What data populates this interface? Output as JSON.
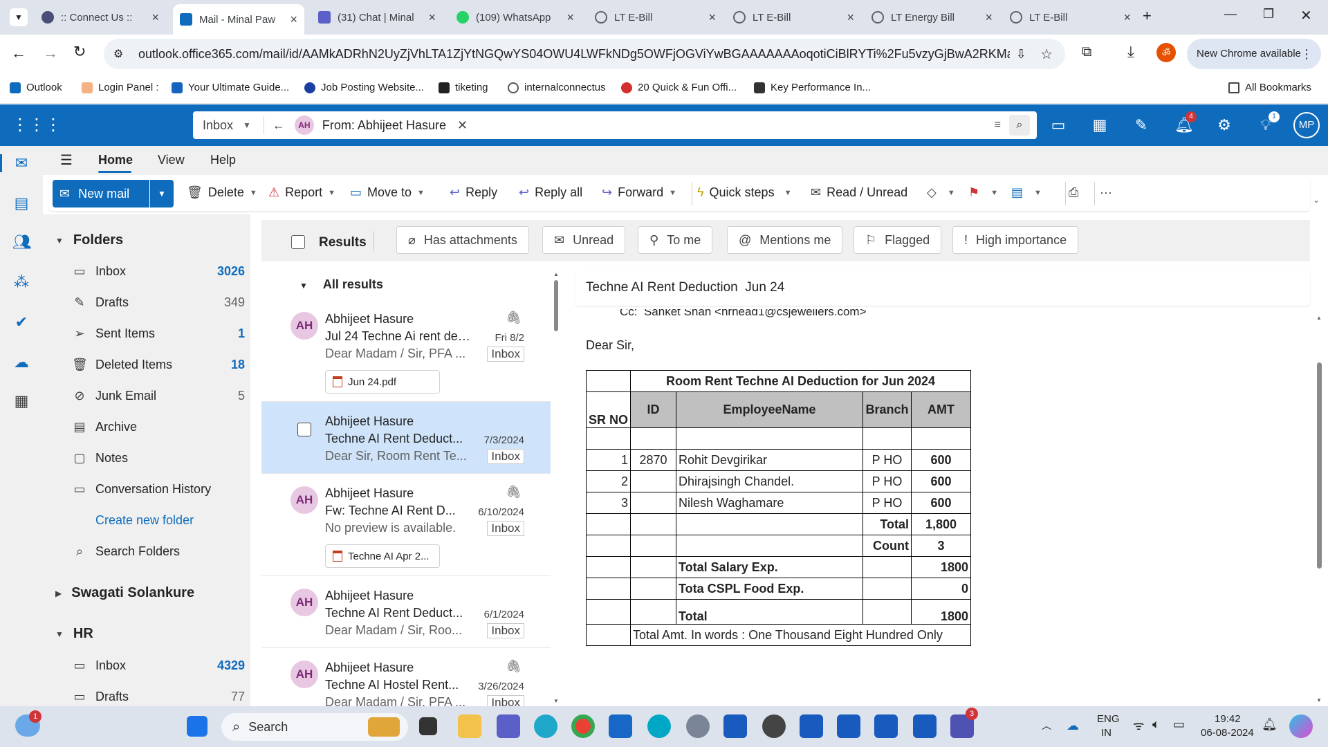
{
  "browser": {
    "tabs": [
      {
        "title": ":: Connect Us ::",
        "color": "#4a4f7a"
      },
      {
        "title": "Mail - Minal Paw",
        "color": "#0f6cbd"
      },
      {
        "title": "(31) Chat | Minal",
        "color": "#5b5fc7"
      },
      {
        "title": "(109) WhatsApp",
        "color": "#25d366"
      },
      {
        "title": "LT E-Bill",
        "color": "#5f6368"
      },
      {
        "title": "LT E-Bill",
        "color": "#5f6368"
      },
      {
        "title": "LT Energy Bill",
        "color": "#5f6368"
      },
      {
        "title": "LT E-Bill",
        "color": "#5f6368"
      }
    ],
    "url": "outlook.office365.com/mail/id/AAMkADRhN2UyZjVhLTA1ZjYtNGQwYS04OWU4LWFkNDg5OWFjOGViYwBGAAAAAAAoqotiCiBlRYTi%2Fu5vzyGjBwA2RKMaHRuO...",
    "new_chrome": "New Chrome available",
    "bookmarks": [
      "Outlook",
      "Login Panel :",
      "Your Ultimate Guide...",
      "Job Posting Website...",
      "tiketing",
      "internalconnectus",
      "20 Quick & Fun Offi...",
      "Key Performance In..."
    ],
    "all_bookmarks": "All Bookmarks"
  },
  "outlook": {
    "search": {
      "scope": "Inbox",
      "avatar": "AH",
      "query": "From: Abhijeet Hasure"
    },
    "badges": {
      "notifications": "4",
      "tips": "1"
    },
    "user_initials": "MP",
    "ribbon_tabs": [
      "Home",
      "View",
      "Help"
    ],
    "ribbon": {
      "new_mail": "New mail",
      "delete": "Delete",
      "report": "Report",
      "move_to": "Move to",
      "reply": "Reply",
      "reply_all": "Reply all",
      "forward": "Forward",
      "quick_steps": "Quick steps",
      "read_unread": "Read / Unread"
    },
    "folders_header": "Folders",
    "folders": [
      {
        "name": "Inbox",
        "count": "3026"
      },
      {
        "name": "Drafts",
        "count": "349"
      },
      {
        "name": "Sent Items",
        "count": "1"
      },
      {
        "name": "Deleted Items",
        "count": "18"
      },
      {
        "name": "Junk Email",
        "count": "5"
      },
      {
        "name": "Archive",
        "count": ""
      },
      {
        "name": "Notes",
        "count": ""
      },
      {
        "name": "Conversation History",
        "count": ""
      }
    ],
    "create_folder": "Create new folder",
    "search_folders": "Search Folders",
    "group2": "Swagati Solankure",
    "group3": "HR",
    "hr_folders": [
      {
        "name": "Inbox",
        "count": "4329"
      },
      {
        "name": "Drafts",
        "count": "77"
      }
    ],
    "results_label": "Results",
    "filters": [
      "Has attachments",
      "Unread",
      "To me",
      "Mentions me",
      "Flagged",
      "High importance"
    ],
    "list_header": "All results",
    "messages": [
      {
        "from": "Abhijeet Hasure",
        "subject": "Jul 24 Techne Ai rent ded...",
        "date": "Fri 8/2",
        "preview": "Dear Madam / Sir, PFA ...",
        "tag": "Inbox",
        "attachment": "Jun 24.pdf",
        "avatar": "AH"
      },
      {
        "from": "Abhijeet Hasure",
        "subject": "Techne AI Rent Deduct...",
        "date": "7/3/2024",
        "preview": "Dear Sir, Room Rent Te...",
        "tag": "Inbox",
        "avatar": "AH"
      },
      {
        "from": "Abhijeet Hasure",
        "subject": "Fw: Techne AI Rent D...",
        "date": "6/10/2024",
        "preview": "No preview is available.",
        "tag": "Inbox",
        "attachment": "Techne AI Apr 2...",
        "avatar": "AH"
      },
      {
        "from": "Abhijeet Hasure",
        "subject": "Techne AI Rent Deduct...",
        "date": "6/1/2024",
        "preview": "Dear Madam / Sir, Roo...",
        "tag": "Inbox",
        "avatar": "AH"
      },
      {
        "from": "Abhijeet Hasure",
        "subject": "Techne AI Hostel Rent...",
        "date": "3/26/2024",
        "preview": "Dear Madam / Sir, PFA ...",
        "tag": "Inbox",
        "avatar": "AH"
      }
    ],
    "reading": {
      "subject": "Techne AI Rent Deduction  Jun 24",
      "cc": "Cc:  Sanket Shah <hrhead1@csjewellers.com>",
      "greeting": "Dear Sir,",
      "table": {
        "title": "Room Rent Techne AI Deduction for Jun 2024",
        "headers": [
          "SR NO",
          "ID",
          "EmployeeName",
          "Branch",
          "AMT"
        ],
        "rows": [
          {
            "sr": "1",
            "id": "2870",
            "name": "Rohit Devgirikar",
            "branch": "P HO",
            "amt": "600"
          },
          {
            "sr": "2",
            "id": "",
            "name": "Dhirajsingh Chandel.",
            "branch": "P HO",
            "amt": "600"
          },
          {
            "sr": "3",
            "id": "",
            "name": "Nilesh Waghamare",
            "branch": "P HO",
            "amt": "600"
          }
        ],
        "total_label": "Total",
        "total": "1,800",
        "count_label": "Count",
        "count": "3",
        "salary_label": "Total Salary Exp.",
        "salary": "1800",
        "food_label": "Tota CSPL Food Exp.",
        "food": "0",
        "grand_label": "Total",
        "grand": "1800",
        "words": "Total Amt. In words : One Thousand Eight Hundred Only"
      }
    }
  },
  "taskbar": {
    "search": "Search",
    "lang": "ENG",
    "region": "IN",
    "time": "19:42",
    "date": "06-08-2024",
    "weather_badge": "1",
    "teams_badge": "3"
  }
}
